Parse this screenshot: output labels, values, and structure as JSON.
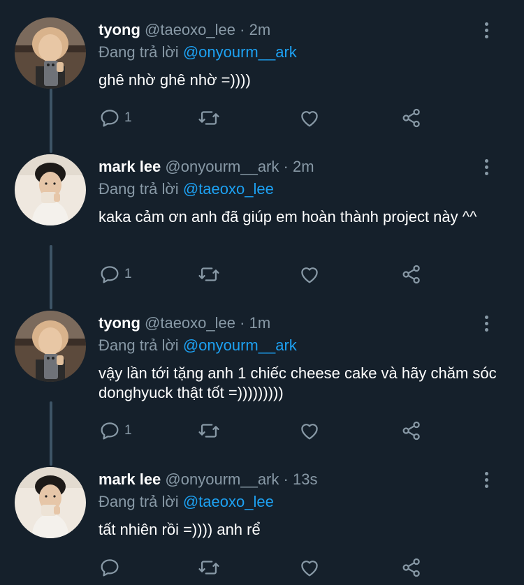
{
  "tweets": [
    {
      "name": "tyong",
      "handle": "@taeoxo_lee",
      "separator": "·",
      "time": "2m",
      "reply_prefix": "Đang trả lời",
      "reply_to": "@onyourm__ark",
      "text": "ghê nhờ ghê nhờ =))))",
      "reply_count": "1",
      "avatar_icon": "avatar-tyong"
    },
    {
      "name": "mark lee",
      "handle": "@onyourm__ark",
      "separator": "·",
      "time": "2m",
      "reply_prefix": "Đang trả lời",
      "reply_to": "@taeoxo_lee",
      "text": "kaka cảm ơn anh đã giúp em hoàn thành project này ^^",
      "reply_count": "1",
      "avatar_icon": "avatar-mark"
    },
    {
      "name": "tyong",
      "handle": "@taeoxo_lee",
      "separator": "·",
      "time": "1m",
      "reply_prefix": "Đang trả lời",
      "reply_to": "@onyourm__ark",
      "text": "vậy lần tới tặng anh 1 chiếc cheese cake và hãy chăm sóc donghyuck thật tốt =)))))))))",
      "reply_count": "1",
      "avatar_icon": "avatar-tyong"
    },
    {
      "name": "mark lee",
      "handle": "@onyourm__ark",
      "separator": "·",
      "time": "13s",
      "reply_prefix": "Đang trả lời",
      "reply_to": "@taeoxo_lee",
      "text": "tất nhiên rồi =)))) anh rể",
      "reply_count": "",
      "avatar_icon": "avatar-mark"
    }
  ],
  "colors": {
    "background": "#15202b",
    "text": "#ffffff",
    "secondary": "#8899a6",
    "link": "#1da1f2",
    "thread_line": "#3d5466"
  },
  "icons": [
    "reply-icon",
    "retweet-icon",
    "like-icon",
    "share-icon",
    "more-icon"
  ]
}
